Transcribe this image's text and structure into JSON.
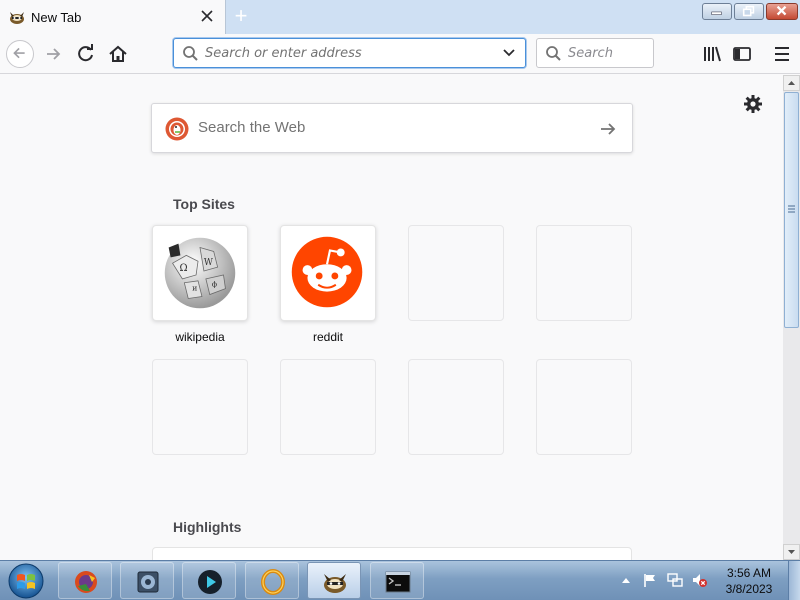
{
  "window": {
    "tab_title": "New Tab",
    "new_tab_symbol": "+"
  },
  "toolbar": {
    "url_placeholder": "Search or enter address",
    "search_placeholder": "Search"
  },
  "newtab": {
    "web_search_placeholder": "Search the Web",
    "top_sites_title": "Top Sites",
    "highlights_title": "Highlights",
    "sites": [
      {
        "label": "wikipedia",
        "icon": "wikipedia-globe-icon"
      },
      {
        "label": "reddit",
        "icon": "reddit-alien-icon"
      }
    ]
  },
  "taskbar": {
    "clock_time": "3:56 AM",
    "clock_date": "3/8/2023",
    "items": [
      "firefox-app-icon",
      "photos-app-icon",
      "media-player-icon",
      "ring-app-icon",
      "firefox-raccoon-icon",
      "terminal-icon"
    ]
  },
  "colors": {
    "accent": "#4a90d9",
    "reddit": "#ff4500",
    "duckduckgo": "#de5833"
  }
}
